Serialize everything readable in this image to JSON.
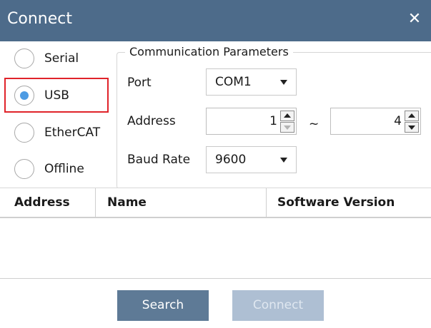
{
  "window": {
    "title": "Connect",
    "close_glyph": "✕"
  },
  "connection_types": [
    {
      "label": "Serial",
      "selected": false
    },
    {
      "label": "USB",
      "selected": true
    },
    {
      "label": "EtherCAT",
      "selected": false
    },
    {
      "label": "Offline",
      "selected": false
    }
  ],
  "params": {
    "legend": "Communication Parameters",
    "port_label": "Port",
    "port_value": "COM1",
    "address_label": "Address",
    "address_from": "1",
    "address_to": "4",
    "range_separator": "~",
    "baud_label": "Baud Rate",
    "baud_value": "9600"
  },
  "table": {
    "columns": [
      "Address",
      "Name",
      "Software Version"
    ],
    "rows": []
  },
  "buttons": {
    "search": "Search",
    "connect": "Connect"
  },
  "colors": {
    "titlebar": "#4d6b8a",
    "radio_selected": "#4d9be3",
    "highlight": "#e0232a",
    "search_button": "#5e7a96",
    "connect_button_disabled": "#aebfd3"
  }
}
